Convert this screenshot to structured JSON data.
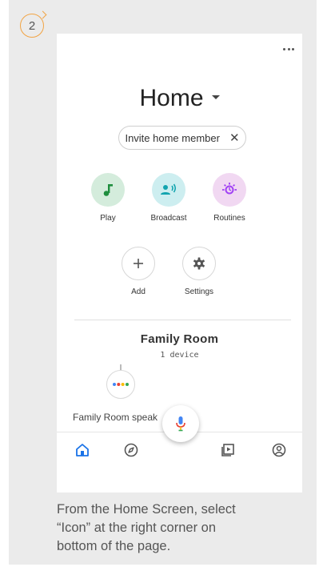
{
  "step": {
    "number": "2"
  },
  "app": {
    "title": "Home",
    "invite_chip": {
      "label": "Invite home member"
    },
    "actions": [
      {
        "label": "Play",
        "icon": "music-note-icon"
      },
      {
        "label": "Broadcast",
        "icon": "broadcast-icon"
      },
      {
        "label": "Routines",
        "icon": "routines-icon"
      }
    ],
    "secondary_actions": [
      {
        "label": "Add",
        "icon": "plus-icon"
      },
      {
        "label": "Settings",
        "icon": "gear-icon"
      }
    ],
    "room": {
      "title": "Family Room",
      "subtitle": "1 device",
      "device_label": "Family Room speak"
    },
    "bottom_nav": [
      "home-icon",
      "explore-icon",
      "media-icon",
      "account-icon"
    ]
  },
  "caption": "From the Home Screen, select “Icon” at the right corner on bottom of the page.",
  "colors": {
    "card_background": "#ebebeb",
    "badge_accent": "#f2a444",
    "play": "#1e8e3e",
    "broadcast": "#12a4af",
    "routines": "#a142f4",
    "home_active": "#1a73e8"
  }
}
